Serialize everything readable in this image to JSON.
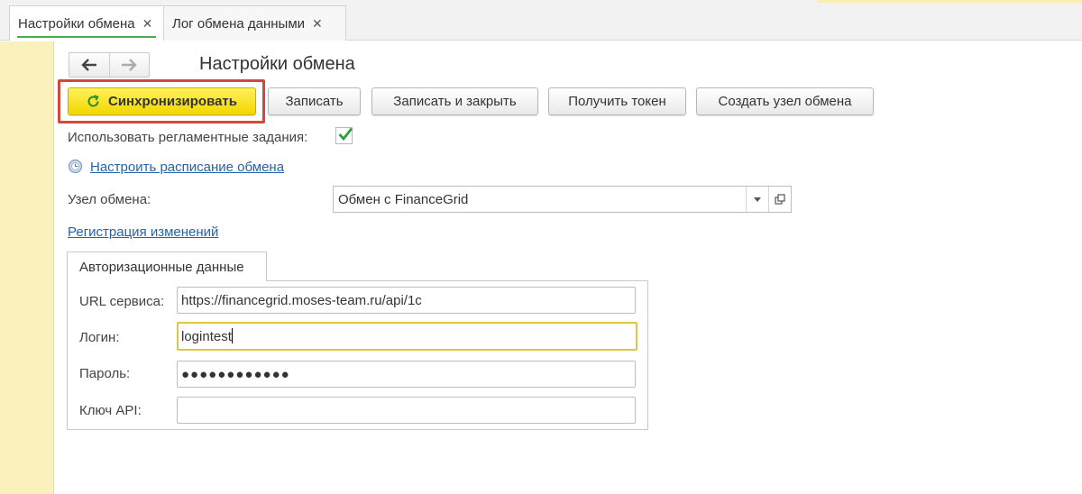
{
  "tabs": [
    {
      "label": "Настройки обмена",
      "active": true
    },
    {
      "label": "Лог обмена данными",
      "active": false
    }
  ],
  "page_title": "Настройки обмена",
  "toolbar": {
    "sync": "Синхронизировать",
    "save": "Записать",
    "save_close": "Записать и закрыть",
    "get_token": "Получить токен",
    "create_node": "Создать узел обмена"
  },
  "form": {
    "use_scheduled_label": "Использовать регламентные задания:",
    "use_scheduled_checked": true,
    "schedule_link": "Настроить расписание обмена",
    "exchange_node_label": "Узел обмена:",
    "exchange_node_value": "Обмен с FinanceGrid",
    "register_changes_link": "Регистрация изменений"
  },
  "auth": {
    "tab_label": "Авторизационные данные",
    "url_label": "URL сервиса:",
    "url_value": "https://financegrid.moses-team.ru/api/1c",
    "login_label": "Логин:",
    "login_value": "logintest",
    "password_label": "Пароль:",
    "password_value": "●●●●●●●●●●●●",
    "api_key_label": "Ключ API:",
    "api_key_value": ""
  },
  "colors": {
    "accent_yellow": "#f2d600",
    "highlight_red": "#d2483a",
    "link_blue": "#2563a8",
    "tab_underline_green": "#4bac4c",
    "side_panel": "#fbf1bd"
  },
  "icons": [
    "close-icon",
    "arrow-left-icon",
    "arrow-right-icon",
    "refresh-icon",
    "checkmark-icon",
    "clock-icon",
    "dropdown-arrow-icon",
    "open-form-icon"
  ]
}
